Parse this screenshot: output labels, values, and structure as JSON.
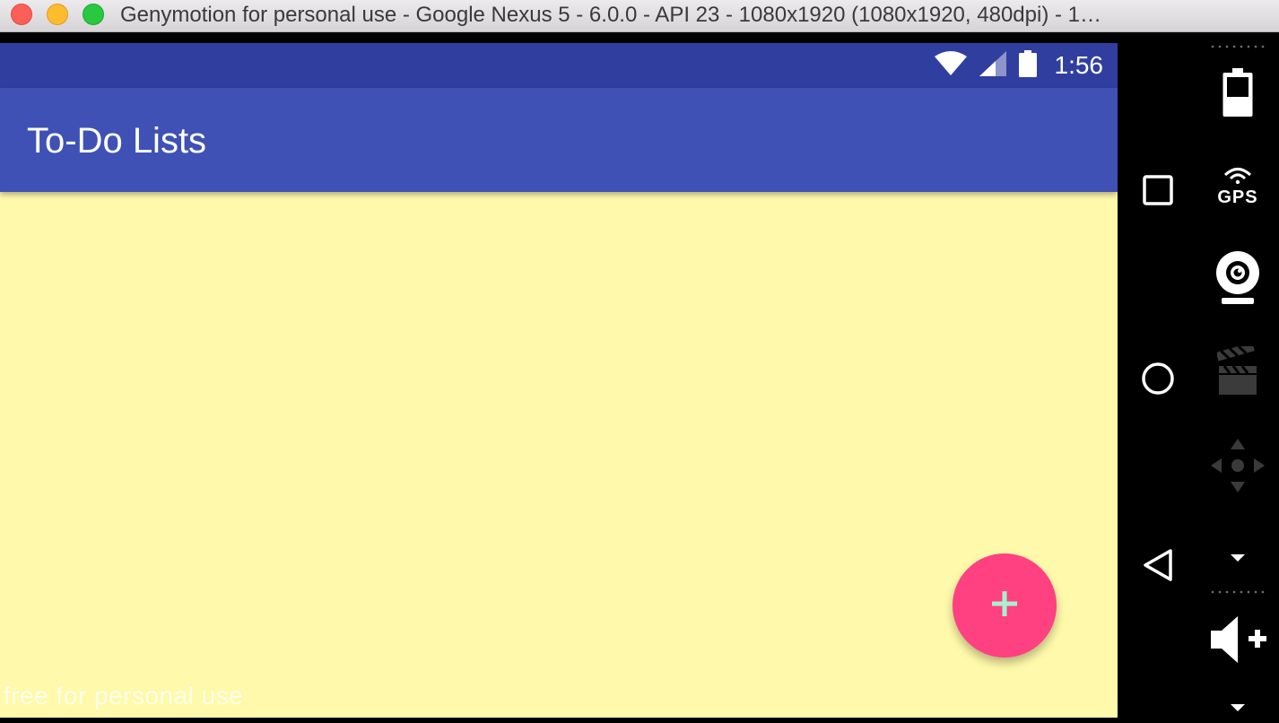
{
  "window": {
    "title": "Genymotion for personal use - Google Nexus 5 - 6.0.0 - API 23 - 1080x1920 (1080x1920, 480dpi) - 1…"
  },
  "status_bar": {
    "time": "1:56",
    "icons": [
      "wifi-icon",
      "cell-signal-icon",
      "battery-icon"
    ]
  },
  "app_bar": {
    "title": "To-Do Lists"
  },
  "fab": {
    "icon": "plus-icon"
  },
  "watermark": "free for personal use",
  "nav_keys": [
    "recents-icon",
    "home-icon",
    "back-icon"
  ],
  "widgets": {
    "gps_label": "GPS",
    "items": [
      "battery-widget-icon",
      "gps-icon",
      "webcam-icon",
      "screencast-icon",
      "dpad-icon",
      "volume-up-icon"
    ]
  },
  "colors": {
    "status_bar": "#303f9f",
    "app_bar": "#3f51b5",
    "content_bg": "#fff9ab",
    "fab": "#ff4081",
    "fab_icon": "#a8f0d2"
  }
}
